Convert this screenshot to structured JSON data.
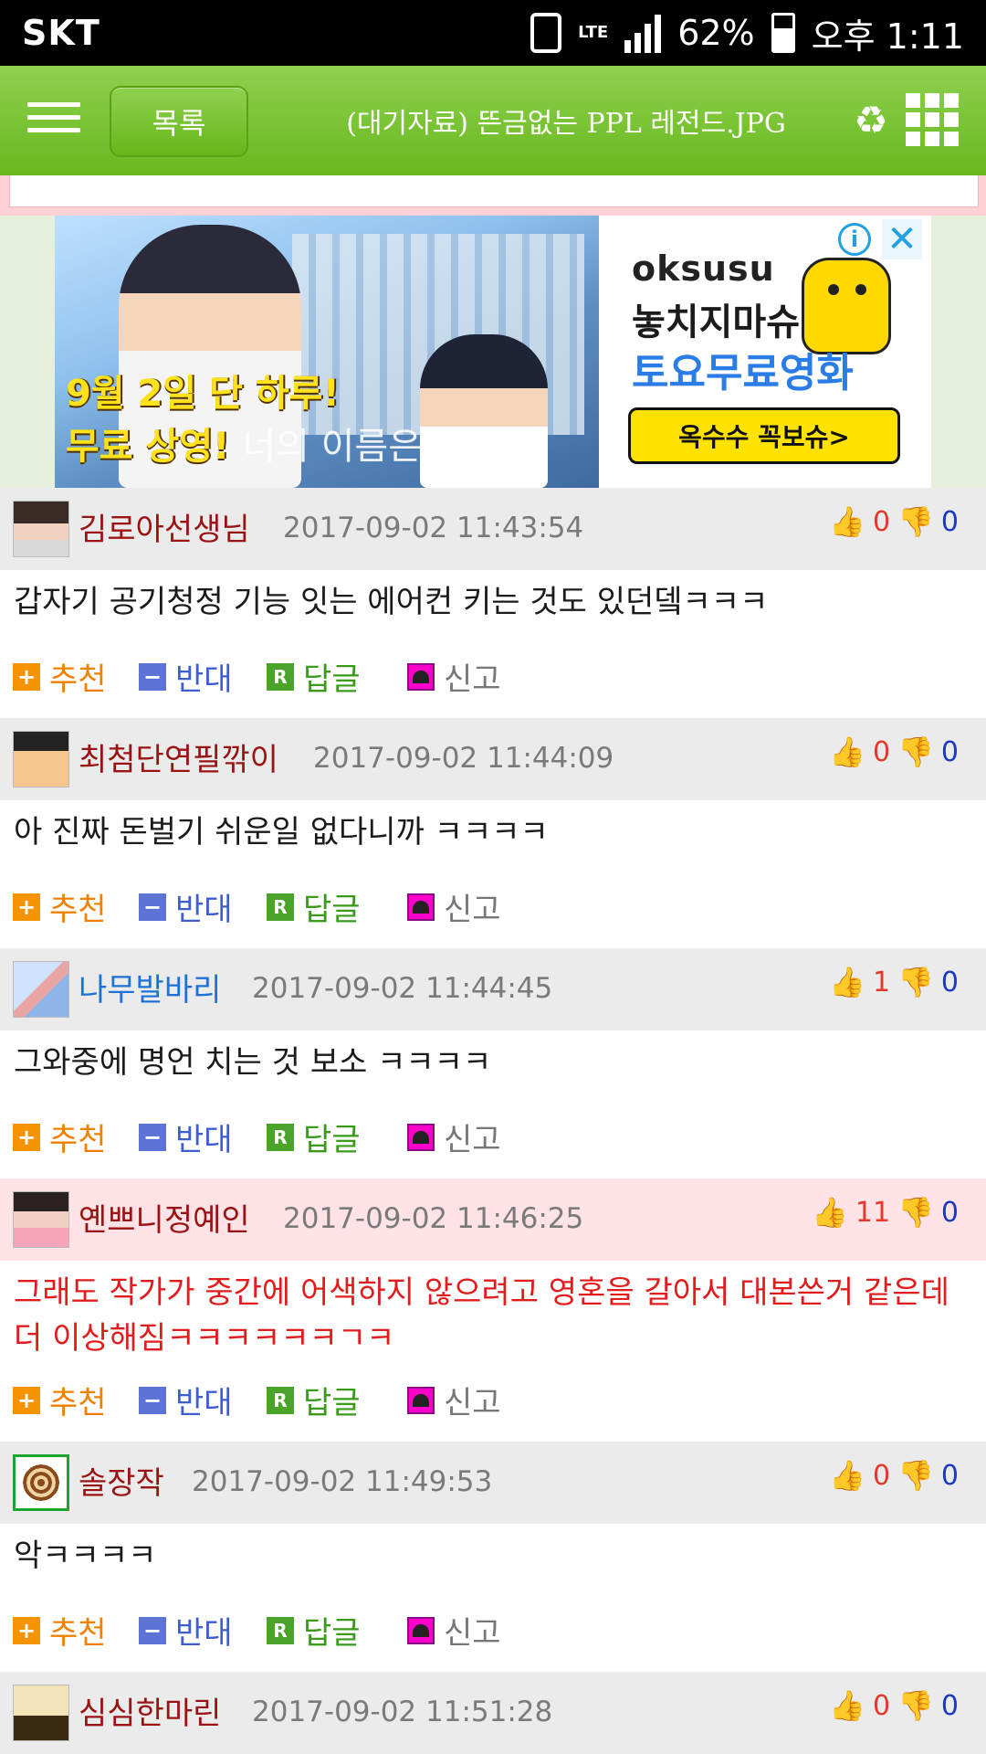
{
  "status_bar": {
    "carrier": "SKT",
    "network": "LTE",
    "battery": "62%",
    "battery_level": 0.62,
    "time": "오후 1:11"
  },
  "header": {
    "list_button": "목록",
    "title": "(대기자료) 뜬금없는 PPL 레전드.JPG"
  },
  "ad": {
    "image_line1": "9월 2일 단 하루!",
    "image_line2": "무료 상영!",
    "image_line2_faded": "너의 이름은.",
    "brand": "oksusu",
    "headline1": "놓치지마슈",
    "headline2": "토요무료영화",
    "cta": "옥수수 꼭보슈>",
    "info": "i",
    "close": "✕"
  },
  "actions": {
    "recommend": "추천",
    "oppose": "반대",
    "reply": "답글",
    "report": "신고"
  },
  "comments": [
    {
      "nick": "김로아선생님",
      "time": "2017-09-02 11:43:54",
      "up": "0",
      "down": "0",
      "text": "갑자기 공기청정 기능 잇는 에어컨 키는 것도 있던뎈ㅋㅋㅋ"
    },
    {
      "nick": "최첨단연필깎이",
      "time": "2017-09-02 11:44:09",
      "up": "0",
      "down": "0",
      "text": "아 진짜 돈벌기 쉬운일 없다니까 ㅋㅋㅋㅋ"
    },
    {
      "nick": "나무발바리",
      "time": "2017-09-02 11:44:45",
      "up": "1",
      "down": "0",
      "text": "그와중에 명언 치는 것 보소 ㅋㅋㅋㅋ"
    },
    {
      "nick": "옌쁘니정예인",
      "time": "2017-09-02 11:46:25",
      "up": "11",
      "down": "0",
      "text": "그래도 작가가 중간에 어색하지 않으려고 영혼을 갈아서 대본쓴거 같은데 더 이상해짐ㅋㅋㅋㅋㅋㅋㄱㅋ"
    },
    {
      "nick": "솔장작",
      "time": "2017-09-02 11:49:53",
      "up": "0",
      "down": "0",
      "text": "악ㅋㅋㅋㅋ"
    },
    {
      "nick": "심심한마린",
      "time": "2017-09-02 11:51:28",
      "up": "0",
      "down": "0",
      "text": ""
    }
  ]
}
